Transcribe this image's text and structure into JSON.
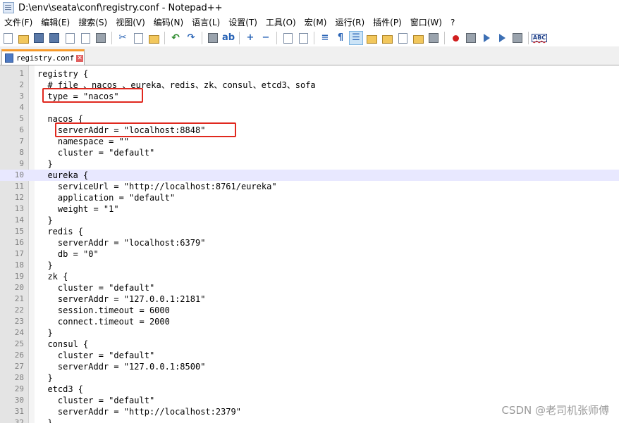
{
  "window": {
    "title": "D:\\env\\seata\\conf\\registry.conf - Notepad++"
  },
  "menu": [
    "文件(F)",
    "编辑(E)",
    "搜索(S)",
    "视图(V)",
    "编码(N)",
    "语言(L)",
    "设置(T)",
    "工具(O)",
    "宏(M)",
    "运行(R)",
    "插件(P)",
    "窗口(W)",
    "?"
  ],
  "tab": {
    "label": "registry.conf",
    "close_glyph": "✕"
  },
  "lines": [
    "registry {",
    "  # file 、nacos 、eureka、redis、zk、consul、etcd3、sofa",
    "  type = \"nacos\"",
    "",
    "  nacos {",
    "    serverAddr = \"localhost:8848\"",
    "    namespace = \"\"",
    "    cluster = \"default\"",
    "  }",
    "  eureka {",
    "    serviceUrl = \"http://localhost:8761/eureka\"",
    "    application = \"default\"",
    "    weight = \"1\"",
    "  }",
    "  redis {",
    "    serverAddr = \"localhost:6379\"",
    "    db = \"0\"",
    "  }",
    "  zk {",
    "    cluster = \"default\"",
    "    serverAddr = \"127.0.0.1:2181\"",
    "    session.timeout = 6000",
    "    connect.timeout = 2000",
    "  }",
    "  consul {",
    "    cluster = \"default\"",
    "    serverAddr = \"127.0.0.1:8500\"",
    "  }",
    "  etcd3 {",
    "    cluster = \"default\"",
    "    serverAddr = \"http://localhost:2379\"",
    "  }"
  ],
  "current_line": 10,
  "watermark": "CSDN @老司机张师傅",
  "colors": {
    "tab_accent": "#f79a2a",
    "highlight_box": "#e0281e",
    "current_line": "#e8e8ff"
  }
}
